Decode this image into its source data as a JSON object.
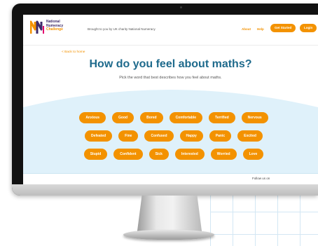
{
  "header": {
    "logo_lines": [
      "National",
      "Numeracy",
      "Challenge"
    ],
    "tagline": "Brought to you by UK charity National Numeracy",
    "nav": {
      "about": "About",
      "help": "Help",
      "get_started": "Get Started",
      "login": "Login"
    }
  },
  "back_link": "< Back to home",
  "title": "How do you feel about maths?",
  "subtitle": "Pick the word that best describes how you feel about maths.",
  "choices": [
    [
      "Anxious",
      "Good",
      "Bored",
      "Comfortable",
      "Terrified",
      "Nervous"
    ],
    [
      "Defeated",
      "Fine",
      "Confused",
      "Happy",
      "Panic",
      "Excited"
    ],
    [
      "Stupid",
      "Confident",
      "Sick",
      "Interested",
      "Worried",
      "Love"
    ]
  ],
  "footer": {
    "follow": "Follow us on"
  },
  "colors": {
    "accent": "#f39200",
    "title": "#1e6a8c",
    "logo_purple": "#3d2a6b",
    "wave": "#dff1fa"
  }
}
